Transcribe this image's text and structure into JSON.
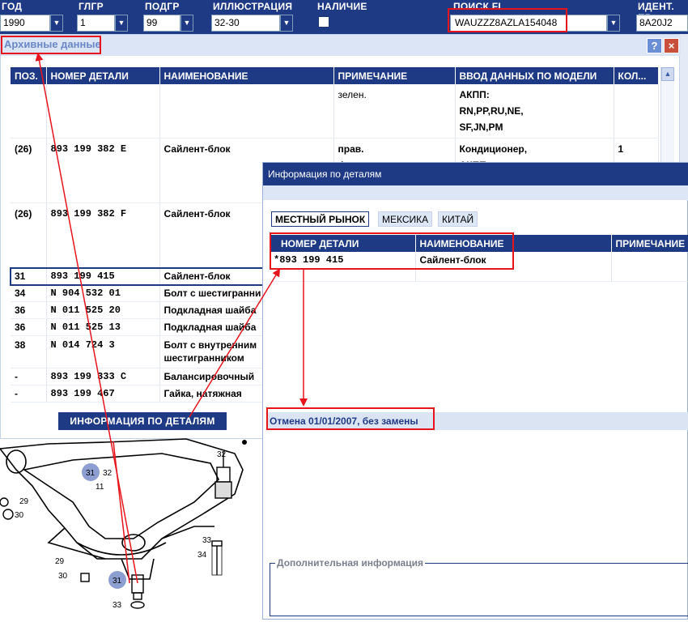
{
  "filters": {
    "year": {
      "label": "ГОД",
      "value": "1990"
    },
    "group": {
      "label": "ГЛГР",
      "value": "1"
    },
    "subgroup": {
      "label": "ПОДГР",
      "value": "99"
    },
    "illustration": {
      "label": "ИЛЛЮСТРАЦИЯ",
      "value": "32-30"
    },
    "availability": {
      "label": "НАЛИЧИЕ"
    },
    "search": {
      "label": "ПОИСК FI",
      "value": "WAUZZZ8AZLA154048"
    },
    "ident": {
      "label": "ИДЕНТ. ПР",
      "value": "8A20J2"
    }
  },
  "archive": {
    "title": "Архивные данные",
    "help_label": "?",
    "close_label": "×",
    "columns": [
      "ПОЗ.",
      "НОМЕР ДЕТАЛИ",
      "НАИМЕНОВАНИЕ",
      "ПРИМЕЧАНИЕ",
      "ВВОД ДАННЫХ ПО МОДЕЛИ",
      "КОЛ..."
    ],
    "rows": [
      {
        "pos": "",
        "number": "",
        "name": "",
        "note": "зелен.",
        "model": [
          "АКПП:",
          "RN,PP,RU,NE,",
          "SF,JN,PM"
        ],
        "qty": ""
      },
      {
        "pos": "(26)",
        "number": "893  199  382  E",
        "name": "Сайлент-блок",
        "note": "прав.\nфиолетов.",
        "model": [
          "Кондиционер,",
          "АКПП:"
        ],
        "qty": "1"
      },
      {
        "pos": "(26)",
        "number": "893  199  382  F",
        "name": "Сайлент-блок",
        "note": "",
        "model": [],
        "qty": ""
      },
      {
        "pos": "31",
        "number": "893  199  415",
        "name": "Сайлент-блок",
        "note": "",
        "model": [],
        "qty": ""
      },
      {
        "pos": "34",
        "number": "N    904  532  01",
        "name": "Болт с шестигранни",
        "note": "",
        "model": [],
        "qty": ""
      },
      {
        "pos": "36",
        "number": "N    011  525  20",
        "name": "Подкладная шайба",
        "note": "",
        "model": [],
        "qty": ""
      },
      {
        "pos": "36",
        "number": "N    011  525  13",
        "name": "Подкладная шайба",
        "note": "",
        "model": [],
        "qty": ""
      },
      {
        "pos": "38",
        "number": "N    014  724  3",
        "name": "Болт с внутренним\nшестигранником",
        "note": "",
        "model": [],
        "qty": ""
      },
      {
        "pos": "-",
        "number": "893  199  333  C",
        "name": "Балансировочный",
        "note": "",
        "model": [],
        "qty": ""
      },
      {
        "pos": "-",
        "number": "893  199  467",
        "name": "Гайка, натяжная",
        "note": "",
        "model": [],
        "qty": ""
      }
    ],
    "info_button_label": "ИНФОРМАЦИЯ ПО ДЕТАЛЯМ"
  },
  "details": {
    "title": "Информация по деталям",
    "tabs": [
      "МЕСТНЫЙ РЫНОК",
      "МЕКСИКА",
      "КИТАЙ"
    ],
    "columns": [
      "НОМЕР ДЕТАЛИ",
      "НАИМЕНОВАНИЕ",
      "ПРИМЕЧАНИЕ"
    ],
    "row": {
      "number": "*893  199  415",
      "name": "Сайлент-блок",
      "note": ""
    },
    "notice": "Отмена 01/01/2007, без замены",
    "extra_title": "Дополнительная информация"
  },
  "diagram": {
    "labels": [
      "31",
      "32",
      "11",
      "32",
      "29",
      "30",
      "33",
      "34",
      "29",
      "30",
      "31",
      "33"
    ]
  }
}
